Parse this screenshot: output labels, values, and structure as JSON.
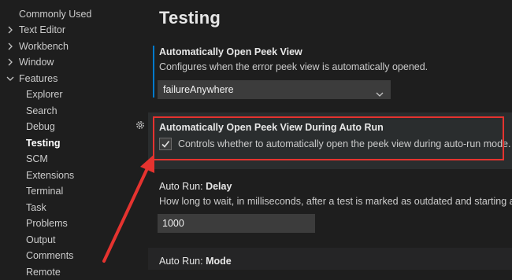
{
  "sidebar": {
    "items": [
      {
        "label": "Commonly Used",
        "level": 0,
        "chevron": "none"
      },
      {
        "label": "Text Editor",
        "level": 0,
        "chevron": "right"
      },
      {
        "label": "Workbench",
        "level": 0,
        "chevron": "right"
      },
      {
        "label": "Window",
        "level": 0,
        "chevron": "right"
      },
      {
        "label": "Features",
        "level": 0,
        "chevron": "down"
      },
      {
        "label": "Explorer",
        "level": 1
      },
      {
        "label": "Search",
        "level": 1
      },
      {
        "label": "Debug",
        "level": 1
      },
      {
        "label": "Testing",
        "level": 1,
        "active": true
      },
      {
        "label": "SCM",
        "level": 1
      },
      {
        "label": "Extensions",
        "level": 1
      },
      {
        "label": "Terminal",
        "level": 1
      },
      {
        "label": "Task",
        "level": 1
      },
      {
        "label": "Problems",
        "level": 1
      },
      {
        "label": "Output",
        "level": 1
      },
      {
        "label": "Comments",
        "level": 1
      },
      {
        "label": "Remote",
        "level": 1
      }
    ]
  },
  "main": {
    "title": "Testing",
    "settings": {
      "open_peek": {
        "title": "Automatically Open Peek View",
        "description": "Configures when the error peek view is automatically opened.",
        "value": "failureAnywhere"
      },
      "open_peek_auto_run": {
        "title": "Automatically Open Peek View During Auto Run",
        "description": "Controls whether to automatically open the peek view during auto-run mode.",
        "checked": true
      },
      "auto_run_delay": {
        "title_prefix": "Auto Run: ",
        "title_name": "Delay",
        "description": "How long to wait, in milliseconds, after a test is marked as outdated and starting a ne",
        "value": "1000"
      },
      "auto_run_mode": {
        "title_prefix": "Auto Run: ",
        "title_name": "Mode"
      }
    }
  },
  "colors": {
    "background": "#1e1e1e",
    "accent": "#007acc",
    "annotation": "#e5332f"
  },
  "icons": [
    "chevron-right-icon",
    "chevron-down-icon",
    "gear-icon",
    "checkmark-icon"
  ]
}
